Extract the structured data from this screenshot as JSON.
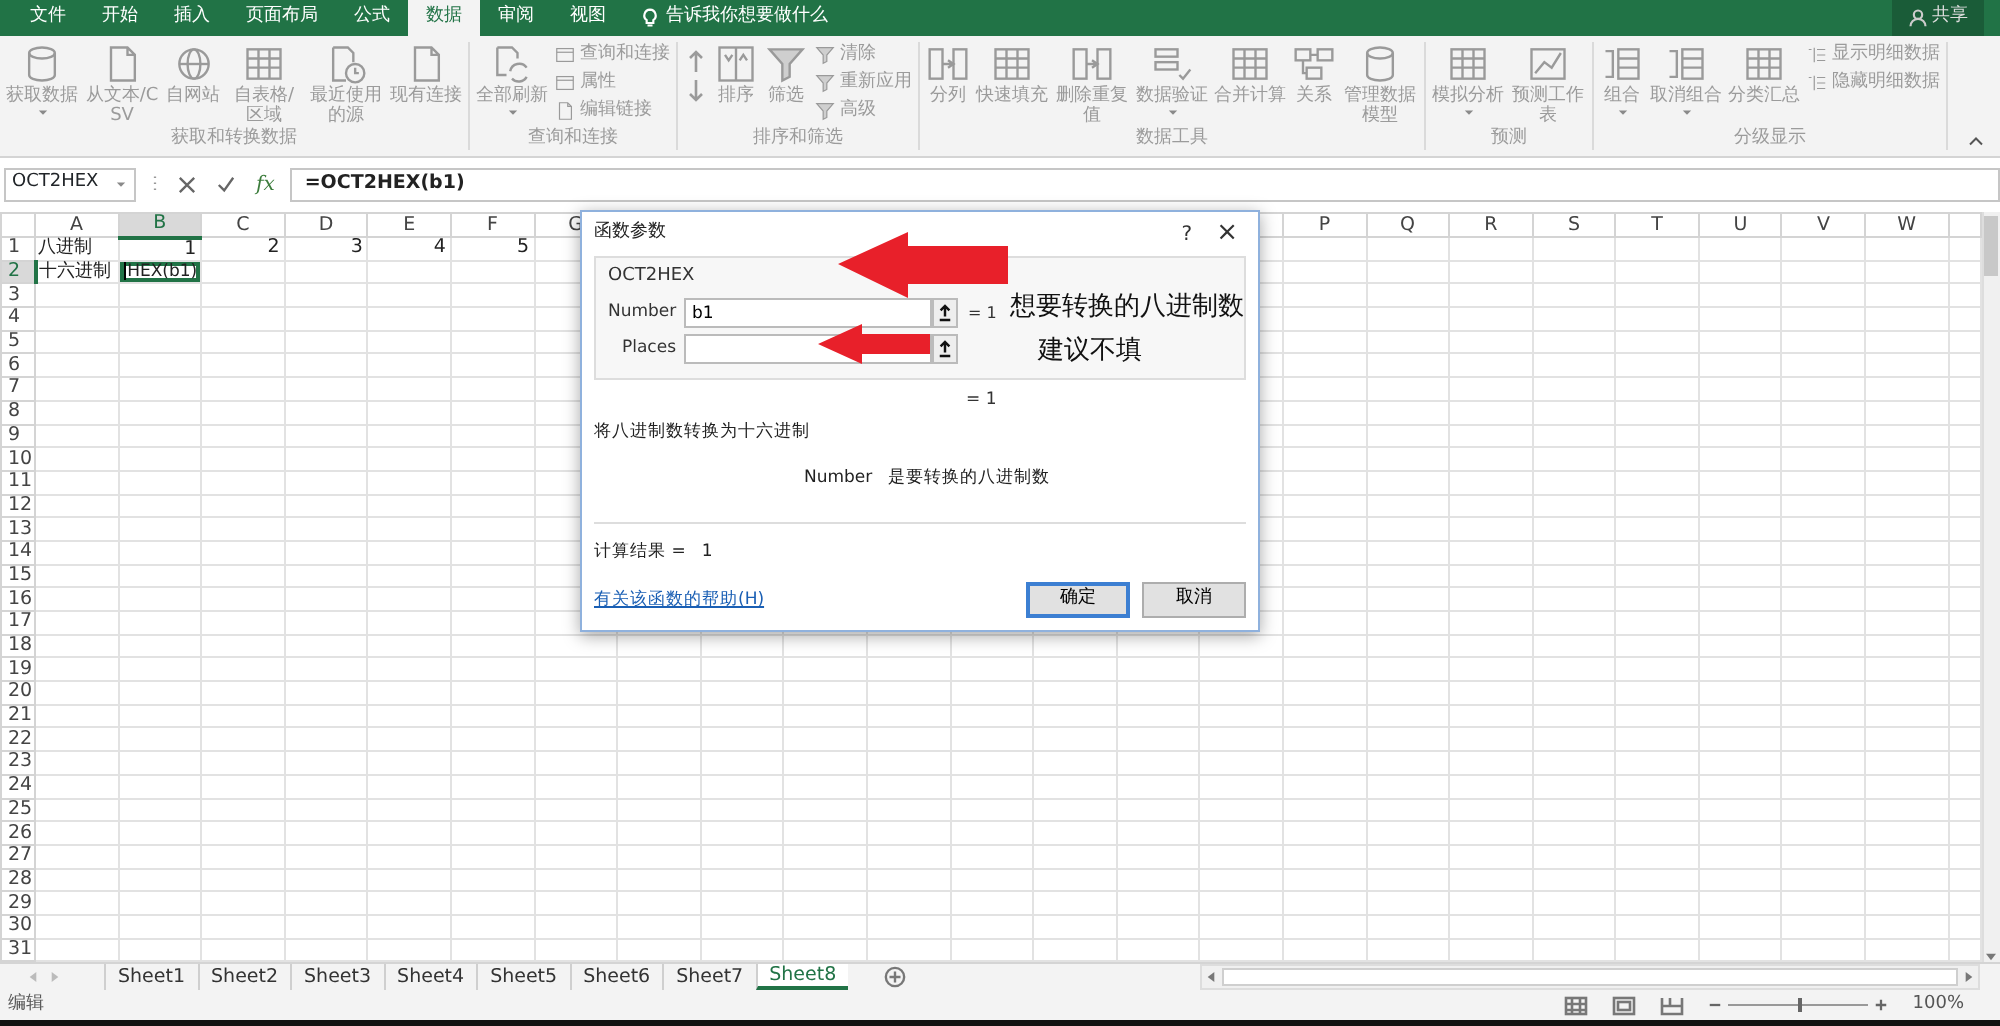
{
  "title_bar": {
    "tabs": [
      {
        "label": "文件",
        "selected": false
      },
      {
        "label": "开始",
        "selected": false
      },
      {
        "label": "插入",
        "selected": false
      },
      {
        "label": "页面布局",
        "selected": false
      },
      {
        "label": "公式",
        "selected": false
      },
      {
        "label": "数据",
        "selected": true
      },
      {
        "label": "审阅",
        "selected": false
      },
      {
        "label": "视图",
        "selected": false
      }
    ],
    "tell_me": "告诉我你想要做什么",
    "share": "共享"
  },
  "ribbon": {
    "disabled": true,
    "groups": [
      {
        "label": "获取和转换数据",
        "items": [
          {
            "kind": "large",
            "label": "获取数据",
            "dropdown": true
          },
          {
            "kind": "large",
            "label": "从文本/CSV",
            "dropdown": false
          },
          {
            "kind": "large",
            "label": "自网站",
            "dropdown": false
          },
          {
            "kind": "large",
            "label": "自表格/区域",
            "dropdown": false
          },
          {
            "kind": "large",
            "label": "最近使用的源",
            "dropdown": false
          },
          {
            "kind": "large",
            "label": "现有连接",
            "dropdown": false
          }
        ]
      },
      {
        "label": "查询和连接",
        "items": [
          {
            "kind": "large",
            "label": "全部刷新",
            "dropdown": true
          },
          {
            "kind": "small",
            "label": "查询和连接"
          },
          {
            "kind": "small",
            "label": "属性"
          },
          {
            "kind": "small",
            "label": "编辑链接"
          }
        ]
      },
      {
        "label": "排序和筛选",
        "items": [
          {
            "kind": "sort-pair"
          },
          {
            "kind": "large",
            "label": "排序",
            "dropdown": false
          },
          {
            "kind": "large",
            "label": "筛选",
            "dropdown": false
          },
          {
            "kind": "small",
            "label": "清除"
          },
          {
            "kind": "small",
            "label": "重新应用"
          },
          {
            "kind": "small",
            "label": "高级"
          }
        ]
      },
      {
        "label": "数据工具",
        "items": [
          {
            "kind": "large",
            "label": "分列",
            "dropdown": false
          },
          {
            "kind": "large",
            "label": "快速填充",
            "dropdown": false
          },
          {
            "kind": "large",
            "label": "删除重复值",
            "dropdown": false
          },
          {
            "kind": "large",
            "label": "数据验证",
            "dropdown": true
          },
          {
            "kind": "large",
            "label": "合并计算",
            "dropdown": false
          },
          {
            "kind": "large",
            "label": "关系",
            "dropdown": false
          },
          {
            "kind": "large",
            "label": "管理数据模型",
            "dropdown": false
          }
        ]
      },
      {
        "label": "预测",
        "items": [
          {
            "kind": "large",
            "label": "模拟分析",
            "dropdown": true
          },
          {
            "kind": "large",
            "label": "预测工作表",
            "dropdown": false
          }
        ]
      },
      {
        "label": "分级显示",
        "items": [
          {
            "kind": "large",
            "label": "组合",
            "dropdown": true
          },
          {
            "kind": "large",
            "label": "取消组合",
            "dropdown": true
          },
          {
            "kind": "large",
            "label": "分类汇总",
            "dropdown": false
          },
          {
            "kind": "small",
            "label": "显示明细数据"
          },
          {
            "kind": "small",
            "label": "隐藏明细数据"
          }
        ]
      }
    ]
  },
  "formula_bar": {
    "name_box": "OCT2HEX",
    "function_button": "fx",
    "formula": "=OCT2HEX(b1)"
  },
  "sheet": {
    "columns": [
      {
        "label": "A",
        "selected": false
      },
      {
        "label": "B",
        "selected": true
      },
      {
        "label": "C",
        "selected": false
      },
      {
        "label": "D",
        "selected": false
      },
      {
        "label": "E",
        "selected": false
      },
      {
        "label": "F",
        "selected": false
      },
      {
        "label": "G",
        "selected": false
      },
      {
        "label": "P",
        "selected": false
      },
      {
        "label": "Q",
        "selected": false
      },
      {
        "label": "R",
        "selected": false
      },
      {
        "label": "S",
        "selected": false
      },
      {
        "label": "T",
        "selected": false
      },
      {
        "label": "U",
        "selected": false
      },
      {
        "label": "V",
        "selected": false
      },
      {
        "label": "W",
        "selected": false
      }
    ],
    "rows": [
      {
        "label": "1",
        "selected": false,
        "cells": [
          {
            "text": "八进制",
            "kind": "text",
            "selected": false,
            "editing": false
          },
          {
            "text": "1",
            "kind": "number",
            "selected": false,
            "editing": false
          },
          {
            "text": "2",
            "kind": "number",
            "selected": false,
            "editing": false
          },
          {
            "text": "3",
            "kind": "number",
            "selected": false,
            "editing": false
          },
          {
            "text": "4",
            "kind": "number",
            "selected": false,
            "editing": false
          },
          {
            "text": "5",
            "kind": "number",
            "selected": false,
            "editing": false
          }
        ]
      },
      {
        "label": "2",
        "selected": true,
        "cells": [
          {
            "text": "十六进制",
            "kind": "text",
            "selected": false,
            "editing": false
          },
          {
            "text": "HEX(b1)",
            "kind": "text",
            "selected": true,
            "editing": true
          }
        ]
      },
      {
        "label": "3",
        "selected": false
      },
      {
        "label": "4",
        "selected": false
      },
      {
        "label": "5",
        "selected": false
      },
      {
        "label": "6",
        "selected": false
      },
      {
        "label": "7",
        "selected": false
      },
      {
        "label": "8",
        "selected": false
      },
      {
        "label": "9",
        "selected": false
      },
      {
        "label": "10",
        "selected": false
      },
      {
        "label": "11",
        "selected": false
      },
      {
        "label": "12",
        "selected": false
      },
      {
        "label": "13",
        "selected": false
      },
      {
        "label": "14",
        "selected": false
      },
      {
        "label": "15",
        "selected": false
      },
      {
        "label": "16",
        "selected": false
      },
      {
        "label": "17",
        "selected": false
      },
      {
        "label": "18",
        "selected": false
      },
      {
        "label": "19",
        "selected": false
      },
      {
        "label": "20",
        "selected": false
      },
      {
        "label": "21",
        "selected": false
      },
      {
        "label": "22",
        "selected": false
      },
      {
        "label": "23",
        "selected": false
      },
      {
        "label": "24",
        "selected": false
      },
      {
        "label": "25",
        "selected": false
      },
      {
        "label": "26",
        "selected": false
      },
      {
        "label": "27",
        "selected": false
      },
      {
        "label": "28",
        "selected": false
      },
      {
        "label": "29",
        "selected": false
      },
      {
        "label": "30",
        "selected": false
      },
      {
        "label": "31",
        "selected": false
      }
    ]
  },
  "sheet_tabs": [
    {
      "label": "Sheet1",
      "selected": false
    },
    {
      "label": "Sheet2",
      "selected": false
    },
    {
      "label": "Sheet3",
      "selected": false
    },
    {
      "label": "Sheet4",
      "selected": false
    },
    {
      "label": "Sheet5",
      "selected": false
    },
    {
      "label": "Sheet6",
      "selected": false
    },
    {
      "label": "Sheet7",
      "selected": false
    },
    {
      "label": "Sheet8",
      "selected": true
    }
  ],
  "status_bar": {
    "mode": "编辑",
    "zoom": {
      "level": 0.5,
      "reading": "100%"
    }
  },
  "dialog": {
    "title": "函数参数",
    "help": "?",
    "close": "×",
    "function_name": "OCT2HEX",
    "args": [
      {
        "label": "Number",
        "value": "b1",
        "result": "= 1"
      },
      {
        "label": "Places"
      }
    ],
    "formula_result": "= 1",
    "description": "将八进制数转换为十六进制",
    "arg_help": {
      "name": "Number",
      "text": "是要转换的八进制数"
    },
    "calc_result_label": "计算结果 =",
    "calc_result": "1",
    "help_link": "有关该函数的帮助(H)",
    "buttons": [
      {
        "label": "确定",
        "default": true
      },
      {
        "label": "取消",
        "default": false
      }
    ]
  },
  "annotations": [
    {
      "text": "想要转换的八进制数"
    },
    {
      "text": "建议不填"
    }
  ]
}
